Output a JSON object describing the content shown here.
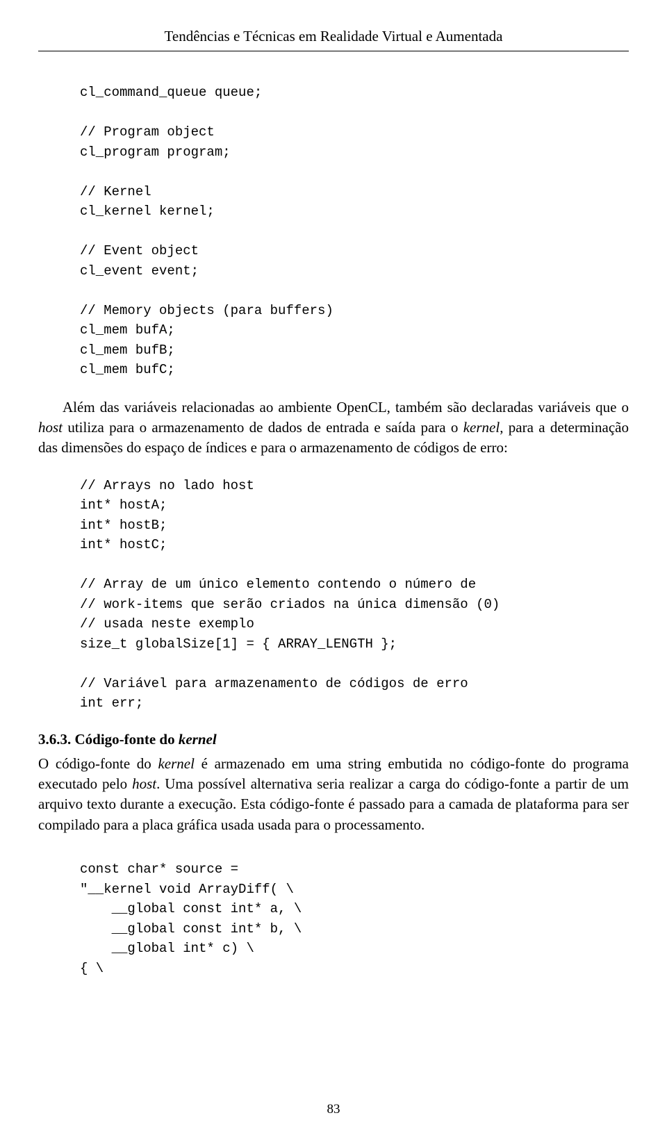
{
  "header": {
    "title": "Tendências e Técnicas em Realidade Virtual e Aumentada"
  },
  "code_block_1": "cl_command_queue queue;\n\n// Program object\ncl_program program;\n\n// Kernel\ncl_kernel kernel;\n\n// Event object\ncl_event event;\n\n// Memory objects (para buffers)\ncl_mem bufA;\ncl_mem bufB;\ncl_mem bufC;",
  "paragraph_1": {
    "prefix": "Além das variáveis relacionadas ao ambiente OpenCL, também são declaradas variáveis que o ",
    "italic_1": "host",
    "part_2": " utiliza para o armazenamento de dados de entrada e saída para o ",
    "italic_2": "kernel",
    "part_3": ", para a determinação das dimensões do espaço de índices e para o armazenamento de códigos de erro:"
  },
  "code_block_2": "// Arrays no lado host\nint* hostA;\nint* hostB;\nint* hostC;\n\n// Array de um único elemento contendo o número de\n// work-items que serão criados na única dimensão (0)\n// usada neste exemplo\nsize_t globalSize[1] = { ARRAY_LENGTH };\n\n// Variável para armazenamento de códigos de erro\nint err;",
  "section": {
    "number": "3.6.3.",
    "title_prefix": "Código-fonte do ",
    "title_italic": "kernel"
  },
  "paragraph_2": {
    "part_1": "O código-fonte do ",
    "italic_1": "kernel",
    "part_2": " é armazenado em uma string embutida no código-fonte do programa executado pelo ",
    "italic_2": "host",
    "part_3": ". Uma possível alternativa seria realizar a carga do código-fonte a partir de um arquivo texto durante a execução. Esta código-fonte é passado para a camada de plataforma para ser compilado para a placa gráfica usada usada para o processamento."
  },
  "code_block_3": "const char* source =\n\"__kernel void ArrayDiff( \\\n    __global const int* a, \\\n    __global const int* b, \\\n    __global int* c) \\\n{ \\",
  "page_number": "83"
}
